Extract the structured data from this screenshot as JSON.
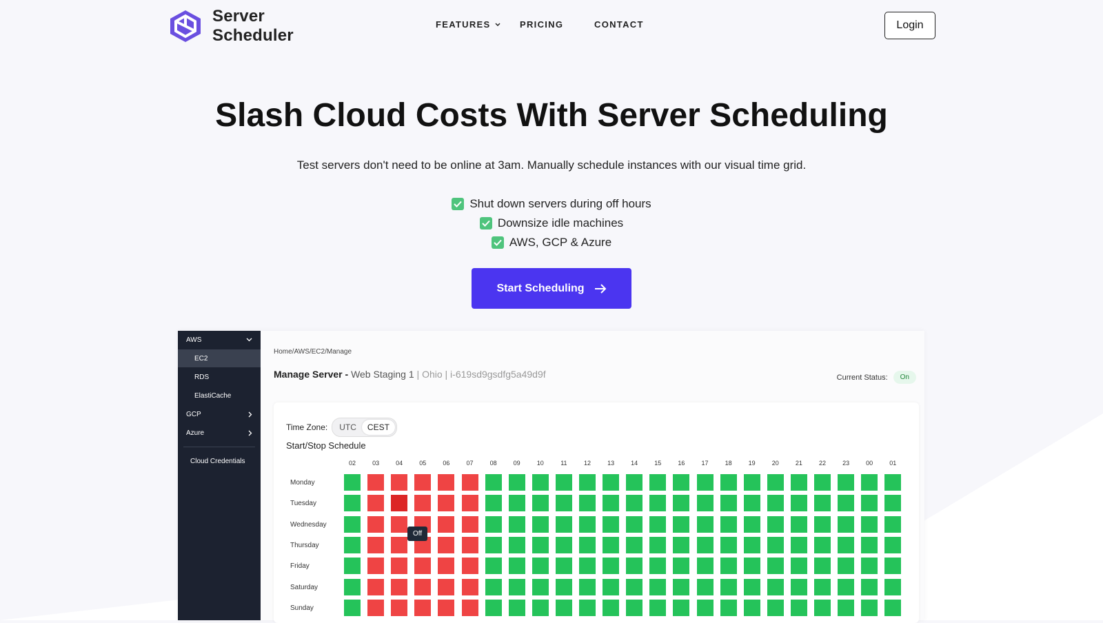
{
  "brand": {
    "line1": "Server",
    "line2": "Scheduler",
    "colors": {
      "primary": "#4b35f0",
      "logo": "#6a4fe0"
    }
  },
  "nav": {
    "features": "FEATURES",
    "pricing": "PRICING",
    "contact": "CONTACT",
    "login": "Login"
  },
  "hero": {
    "title": "Slash Cloud Costs With Server Scheduling",
    "subtitle": "Test servers don't need to be online at 3am. Manually schedule instances with our visual time grid.",
    "features": [
      "Shut down servers during off hours",
      "Downsize idle machines",
      "AWS, GCP & Azure"
    ],
    "cta": "Start Scheduling"
  },
  "sidebar": {
    "aws": "AWS",
    "aws_items": [
      "EC2",
      "RDS",
      "ElastiCache"
    ],
    "gcp": "GCP",
    "azure": "Azure",
    "credentials": "Cloud Credentials"
  },
  "manage": {
    "breadcrumb": "Home/AWS/EC2/Manage",
    "title_prefix": "Manage Server -",
    "server_name": "Web Staging 1",
    "meta": "| Ohio | i-619sd9gsdfg5a49d9f",
    "status_label": "Current Status:",
    "status_value": "On"
  },
  "schedule": {
    "timezone_label": "Time Zone:",
    "timezones": [
      "UTC",
      "CEST"
    ],
    "selected_timezone": "CEST",
    "title": "Start/Stop Schedule",
    "hours": [
      "02",
      "03",
      "04",
      "05",
      "06",
      "07",
      "08",
      "09",
      "10",
      "11",
      "12",
      "13",
      "14",
      "15",
      "16",
      "17",
      "18",
      "19",
      "20",
      "21",
      "22",
      "23",
      "00",
      "01"
    ],
    "days": [
      "Monday",
      "Tuesday",
      "Wednesday",
      "Thursday",
      "Friday",
      "Saturday",
      "Sunday"
    ],
    "off_hours": [
      "03",
      "04",
      "05",
      "06",
      "07"
    ],
    "highlighted": {
      "day": "Tuesday",
      "hour": "04"
    },
    "tooltip": "Off"
  }
}
